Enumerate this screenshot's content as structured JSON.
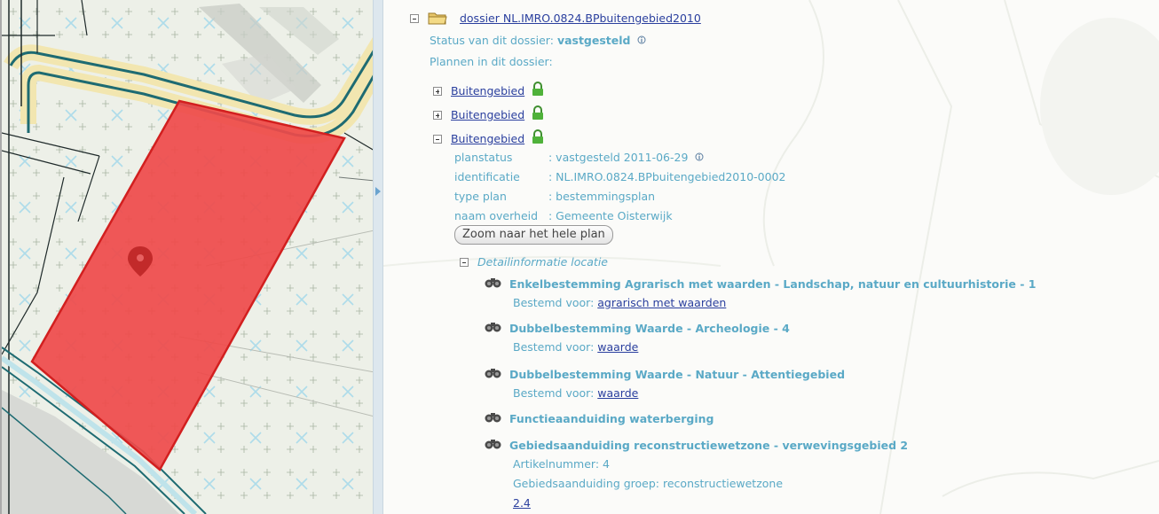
{
  "dossier": {
    "title": "dossier NL.IMRO.0824.BPbuitengebied2010",
    "status_label": "Status van dit dossier:",
    "status_value": "vastgesteld",
    "plans_label": "Plannen in dit dossier:"
  },
  "plans": [
    {
      "label": "Buitengebied",
      "expanded": false
    },
    {
      "label": "Buitengebied",
      "expanded": false
    },
    {
      "label": "Buitengebied",
      "expanded": true
    }
  ],
  "plan_details": [
    {
      "key": "planstatus",
      "value": ": vastgesteld 2011-06-29"
    },
    {
      "key": "identificatie",
      "value": ": NL.IMRO.0824.BPbuitengebied2010-0002"
    },
    {
      "key": "type plan",
      "value": ": bestemmingsplan"
    },
    {
      "key": "naam overheid",
      "value": ": Gemeente Oisterwijk"
    }
  ],
  "zoom_button_label": "Zoom naar het hele plan",
  "detail_section_title": "Detailinformatie locatie",
  "details": [
    {
      "title": "Enkelbestemming Agrarisch met waarden - Landschap, natuur en cultuurhistorie - 1",
      "sub_label": "Bestemd voor:",
      "sub_link": "agrarisch met waarden"
    },
    {
      "title": "Dubbelbestemming Waarde - Archeologie - 4",
      "sub_label": "Bestemd voor:",
      "sub_link": "waarde"
    },
    {
      "title": "Dubbelbestemming Waarde - Natuur - Attentiegebied",
      "sub_label": "Bestemd voor:",
      "sub_link": "waarde"
    },
    {
      "title": "Functieaanduiding waterberging"
    },
    {
      "title": "Gebiedsaanduiding reconstructiewetzone - verwevingsgebied 2",
      "lines": [
        "Artikelnummer: 4",
        "Gebiedsaanduiding groep: reconstructiewetzone"
      ],
      "link": "2.4"
    }
  ],
  "colors": {
    "accent_text": "#5aa9c6",
    "link": "#2a3f9e",
    "plan_area_fill": "#ef4a4a",
    "plan_area_stroke": "#d21f1f",
    "road_fill": "#f3e7b4",
    "map_line": "#1e6b72",
    "lock_green": "#4fb23a"
  },
  "icons": {
    "folder": "folder-icon",
    "lock": "lock-icon",
    "info": "info-icon",
    "binoculars": "binoculars-icon",
    "marker": "map-marker-icon",
    "expand": "expand-plus-icon",
    "collapse": "collapse-minus-icon"
  }
}
